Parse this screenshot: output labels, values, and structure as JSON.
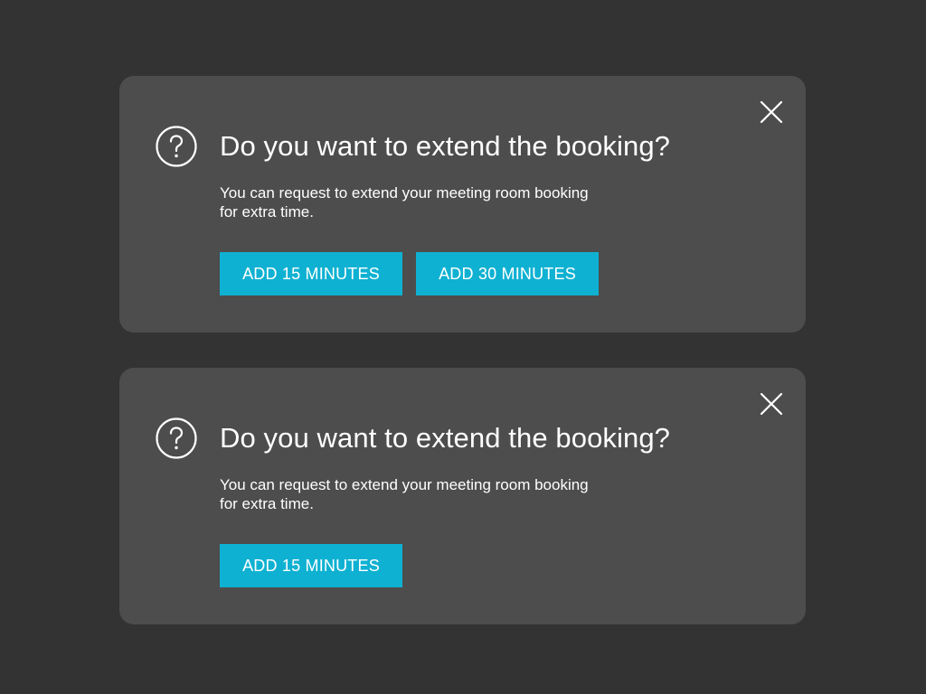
{
  "colors": {
    "background": "#333333",
    "dialog": "#4d4d4d",
    "accent": "#0fb1d2",
    "text": "#ffffff"
  },
  "dialogs": [
    {
      "icon": "question-circle-icon",
      "close_icon": "close-icon",
      "title": "Do you want to extend the booking?",
      "description": "You can request to extend your meeting room booking\nfor extra time.",
      "buttons": [
        "ADD 15 MINUTES",
        "ADD 30 MINUTES"
      ]
    },
    {
      "icon": "question-circle-icon",
      "close_icon": "close-icon",
      "title": "Do you want to extend the booking?",
      "description": "You can request to extend your meeting room booking\nfor extra time.",
      "buttons": [
        "ADD 15 MINUTES"
      ]
    }
  ]
}
